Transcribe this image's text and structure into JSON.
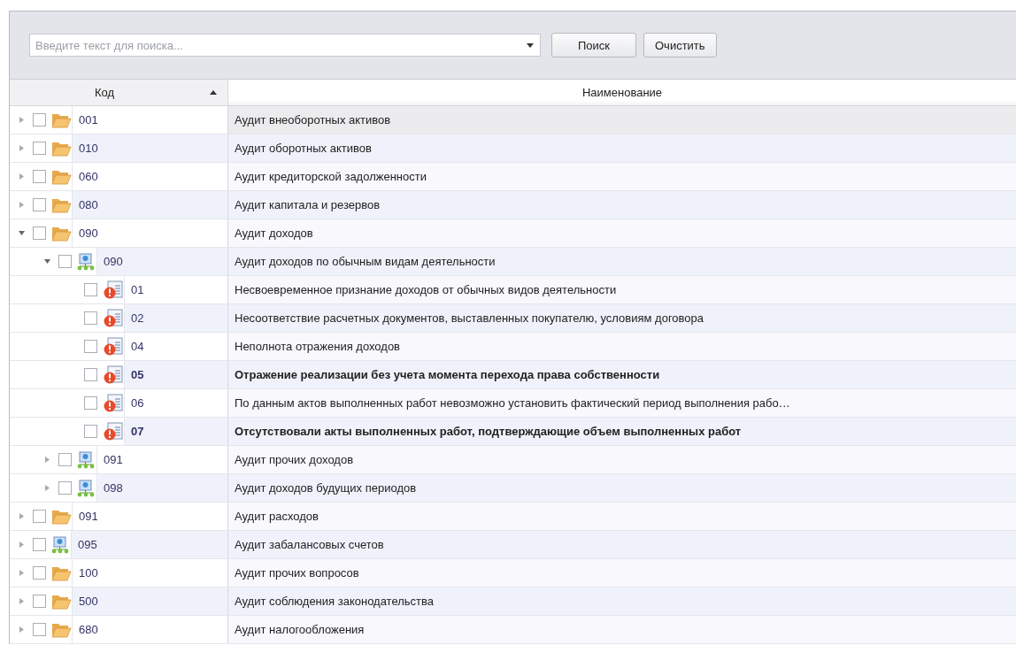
{
  "toolbar": {
    "search": {
      "placeholder": "Введите текст для поиска..."
    },
    "buttons": [
      {
        "label": "Поиск"
      },
      {
        "label": "Очистить"
      }
    ]
  },
  "table": {
    "columns": [
      {
        "label": "Код",
        "sorted_ascending": true
      },
      {
        "label": "Наименование"
      }
    ],
    "rows": [
      {
        "code": "001",
        "name": "Аудит внеоборотных активов",
        "kind": "folder",
        "checked": false,
        "expanded": false,
        "selected": true,
        "bold": false
      },
      {
        "code": "010",
        "name": "Аудит оборотных активов",
        "kind": "folder",
        "checked": false,
        "expanded": false,
        "selected": false,
        "bold": false
      },
      {
        "code": "060",
        "name": "Аудит кредиторской задолженности",
        "kind": "folder",
        "checked": false,
        "expanded": false,
        "selected": false,
        "bold": false
      },
      {
        "code": "080",
        "name": "Аудит капитала и резервов",
        "kind": "folder",
        "checked": false,
        "expanded": false,
        "selected": false,
        "bold": false
      },
      {
        "code": "090",
        "name": "Аудит доходов",
        "kind": "folder",
        "checked": false,
        "expanded": true,
        "selected": false,
        "bold": false,
        "children": [
          {
            "code": "090",
            "name": "Аудит доходов по обычным видам деятельности",
            "kind": "hierarchy",
            "checked": false,
            "expanded": true,
            "selected": false,
            "bold": false,
            "children": [
              {
                "code": "01",
                "name": "Несвоевременное признание доходов от обычных видов деятельности",
                "kind": "risk",
                "checked": false,
                "selected": false,
                "bold": false
              },
              {
                "code": "02",
                "name": "Несоответствие расчетных документов, выставленных покупателю, условиям договора",
                "kind": "risk",
                "checked": false,
                "selected": false,
                "bold": false
              },
              {
                "code": "04",
                "name": "Неполнота отражения доходов",
                "kind": "risk",
                "checked": false,
                "selected": false,
                "bold": false
              },
              {
                "code": "05",
                "name": "Отражение реализации без учета момента перехода права собственности",
                "kind": "risk",
                "checked": false,
                "selected": false,
                "bold": true
              },
              {
                "code": "06",
                "name": "По данным актов выполненных работ невозможно установить фактический период выполнения рабо…",
                "kind": "risk",
                "checked": false,
                "selected": false,
                "bold": false
              },
              {
                "code": "07",
                "name": "Отсутствовали акты выполненных работ, подтверждающие объем выполненных работ",
                "kind": "risk",
                "checked": false,
                "selected": false,
                "bold": true
              }
            ]
          },
          {
            "code": "091",
            "name": "Аудит прочих доходов",
            "kind": "hierarchy",
            "checked": false,
            "expanded": false,
            "selected": false,
            "bold": false
          },
          {
            "code": "098",
            "name": "Аудит доходов будущих периодов",
            "kind": "hierarchy",
            "checked": false,
            "expanded": false,
            "selected": false,
            "bold": false
          }
        ]
      },
      {
        "code": "091",
        "name": "Аудит расходов",
        "kind": "folder",
        "checked": false,
        "expanded": false,
        "selected": false,
        "bold": false
      },
      {
        "code": "095",
        "name": "Аудит забалансовых счетов",
        "kind": "hierarchy",
        "checked": false,
        "expanded": false,
        "selected": false,
        "bold": false
      },
      {
        "code": "100",
        "name": "Аудит прочих вопросов",
        "kind": "folder",
        "checked": false,
        "expanded": false,
        "selected": false,
        "bold": false
      },
      {
        "code": "500",
        "name": "Аудит соблюдения законодательства",
        "kind": "folder",
        "checked": false,
        "expanded": false,
        "selected": false,
        "bold": false
      },
      {
        "code": "680",
        "name": "Аудит налогообложения",
        "kind": "folder",
        "checked": false,
        "expanded": false,
        "selected": false,
        "bold": false
      }
    ]
  }
}
